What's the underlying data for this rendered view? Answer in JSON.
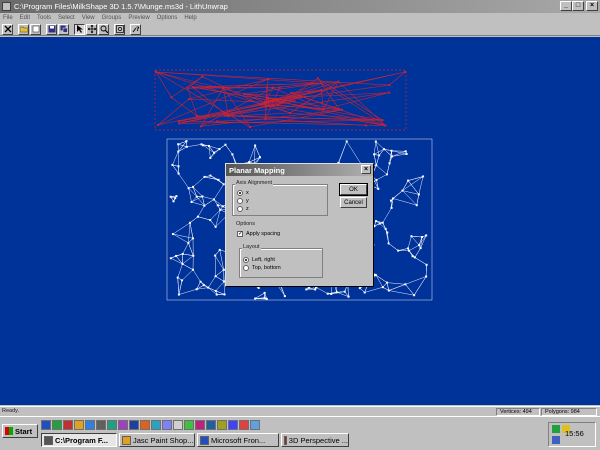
{
  "window": {
    "title": "C:\\Program Files\\MilkShape 3D 1.5.7\\Munge.ms3d - LithUnwrap",
    "buttons": {
      "minimize": "_",
      "maximize": "□",
      "close": "×"
    }
  },
  "menu": [
    "File",
    "Edit",
    "Tools",
    "Select",
    "View",
    "Groups",
    "Preview",
    "Options",
    "Help"
  ],
  "toolbar": {
    "icons": [
      "new-icon",
      "open-icon",
      "close-file-icon",
      "save-icon",
      "save-as-icon",
      "pointer-icon",
      "move-icon",
      "zoom-icon",
      "zoom-fit-icon",
      "help-icon"
    ]
  },
  "dialog": {
    "title": "Planar Mapping",
    "axis_group_label": "Axis Alignment",
    "axis_options": [
      "x",
      "y",
      "z"
    ],
    "axis_selected": "x",
    "options_label": "Options",
    "apply_spacing_label": "Apply spacing",
    "apply_spacing_checked": true,
    "layout_label": "Layout",
    "layout_options": [
      "Left, right",
      "Top, bottom"
    ],
    "layout_selected": "Left, right",
    "ok_label": "OK",
    "cancel_label": "Cancel",
    "close_glyph": "×"
  },
  "statusbar": {
    "ready": "Ready.",
    "vertices": "Vertices: 494",
    "polygons": "Polygons: 984"
  },
  "taskbar": {
    "start_label": "Start",
    "tasks": [
      {
        "label": "C:\\Program F...",
        "active": true
      },
      {
        "label": "Jasc Paint Shop...",
        "active": false
      },
      {
        "label": "Microsoft Fron...",
        "active": false
      },
      {
        "label": "3D Perspective ...",
        "active": false
      }
    ],
    "clock": "15:56"
  },
  "colors": {
    "viewport_bg": "#003399",
    "wire_red": "#cc2233",
    "wire_white": "#f0f0ff",
    "chrome": "#c0c0c0"
  }
}
